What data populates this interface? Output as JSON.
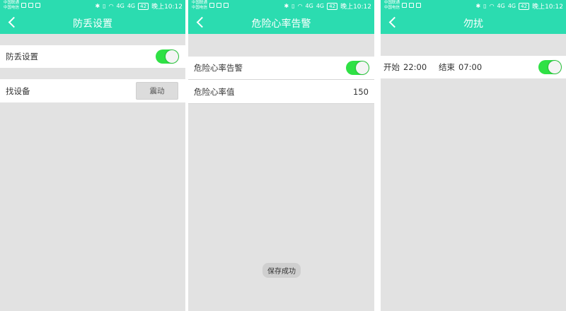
{
  "status_bar": {
    "carrier_line1": "中国联通",
    "carrier_line2": "中国电信",
    "signal_1": "4G",
    "signal_2": "4G",
    "battery": "42",
    "time": "晚上10:12"
  },
  "screens": {
    "anti_loss": {
      "title": "防丢设置",
      "rows": [
        {
          "label": "防丢设置",
          "toggle_on": true
        },
        {
          "label": "找设备",
          "button_label": "震动"
        }
      ]
    },
    "heart_rate": {
      "title": "危险心率告警",
      "rows": [
        {
          "label": "危险心率告警",
          "toggle_on": true
        },
        {
          "label": "危险心率值",
          "value": "150"
        }
      ],
      "toast": "保存成功"
    },
    "dnd": {
      "title": "勿扰",
      "start_label": "开始",
      "start_time": "22:00",
      "end_label": "结束",
      "end_time": "07:00",
      "toggle_on": true
    }
  },
  "colors": {
    "header": "#2bdcb0",
    "toggle_on": "#2fe145",
    "background": "#e2e2e2"
  }
}
